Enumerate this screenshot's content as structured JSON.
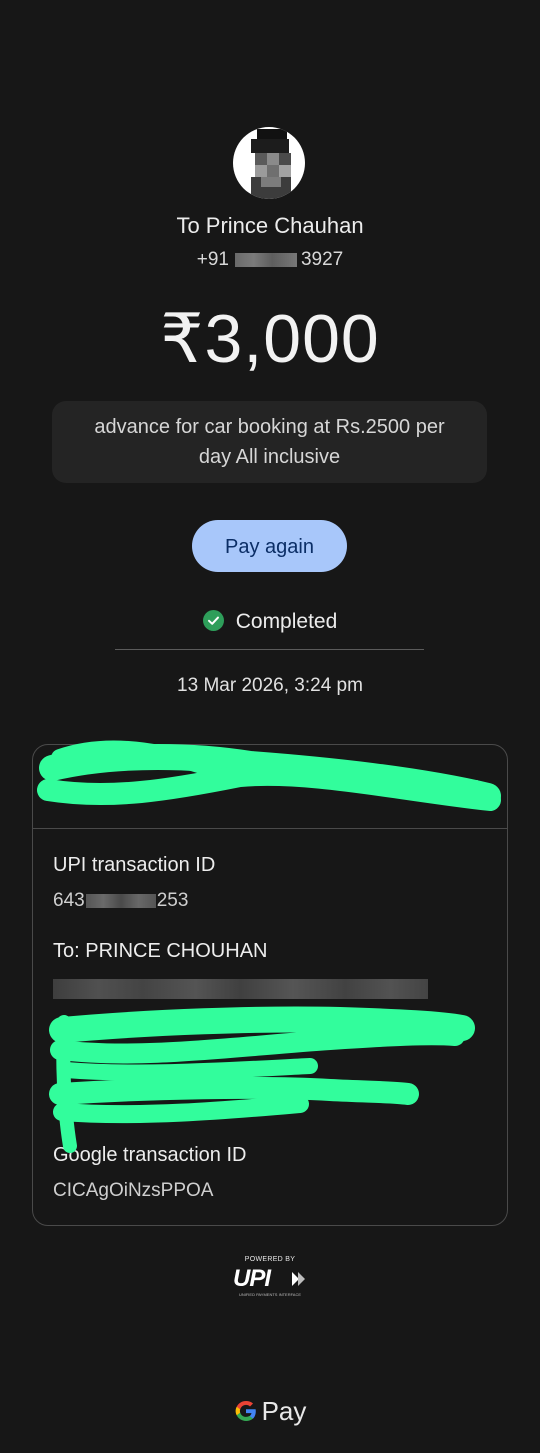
{
  "recipient": {
    "title": "To Prince Chauhan",
    "phone_prefix": "+91",
    "phone_suffix": "3927"
  },
  "payment": {
    "amount": "₹3,000",
    "note": "advance for car booking at Rs.2500 per day All inclusive",
    "pay_again_label": "Pay again",
    "status": "Completed",
    "timestamp": "13 Mar 2026, 3:24 pm"
  },
  "details": {
    "upi_label": "UPI transaction ID",
    "upi_prefix": "643",
    "upi_suffix": "253",
    "to_label": "To: PRINCE CHOUHAN",
    "google_label": "Google transaction ID",
    "google_value": "CICAgOiNzsPPOA"
  },
  "footer": {
    "powered_by": "POWERED BY",
    "upi_wordmark": "UPI",
    "upi_tagline": "UNIFIED PAYMENTS INTERFACE",
    "gpay_label": "Pay"
  },
  "colors": {
    "background": "#171717",
    "pay_again_bg": "#a8c7fa",
    "success_green": "#2e9e5a",
    "scribble": "#32fd9c"
  },
  "icons": [
    "avatar",
    "check-circle-icon",
    "chevron-down-icon",
    "upi-logo",
    "google-g-icon"
  ]
}
